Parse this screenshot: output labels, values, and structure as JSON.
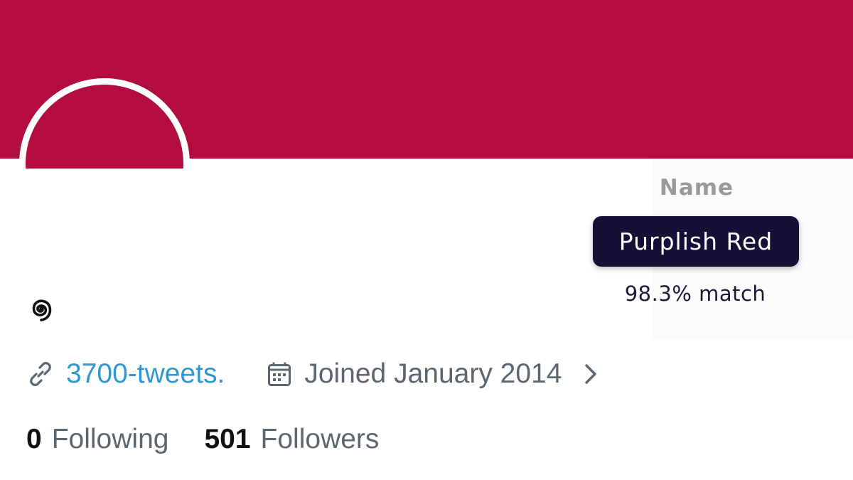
{
  "profile": {
    "banner_color": "#b30d40",
    "website_link": "3700-tweets.",
    "joined": "Joined January 2014",
    "following_count": "0",
    "following_label": "Following",
    "followers_count": "501",
    "followers_label": "Followers"
  },
  "color_match": {
    "heading": "Name",
    "color_name": "Purplish Red",
    "match": "98.3% match"
  },
  "icons": {
    "bio_icon": "spiral-icon",
    "link_icon": "link-icon",
    "calendar_icon": "calendar-icon",
    "chevron_icon": "chevron-right-icon"
  }
}
